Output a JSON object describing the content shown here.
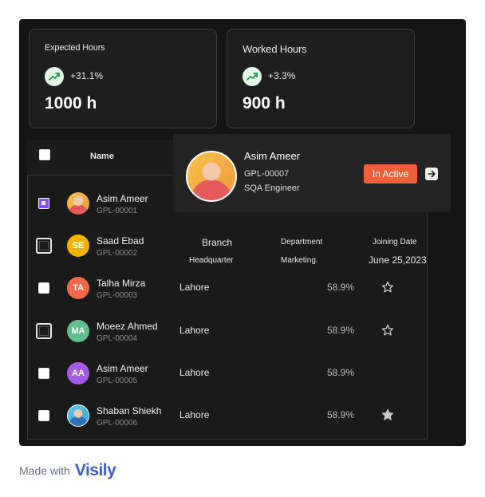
{
  "stats": [
    {
      "title": "Expected Hours",
      "change": "+31.1%",
      "value": "1000 h"
    },
    {
      "title": "Worked Hours",
      "change": "+3.3%",
      "value": "900 h"
    }
  ],
  "table": {
    "header_name": "Name",
    "sub_header": {
      "branch": "Branch",
      "department": "Department",
      "joining": "Joining Date"
    },
    "sub_values": {
      "branch": "Headquarter",
      "department": "Marketing.",
      "joining": "June 25,2023"
    },
    "rows": [
      {
        "name": "Asim Ameer",
        "id": "GPL-00001",
        "initials": "",
        "location": "",
        "percent": ""
      },
      {
        "name": "Saad Ebad",
        "id": "GPL-00002",
        "initials": "SE",
        "location": "",
        "percent": ""
      },
      {
        "name": "Talha Mirza",
        "id": "GPL-00003",
        "initials": "TA",
        "location": "Lahore",
        "percent": "58.9%"
      },
      {
        "name": "Moeez Ahmed",
        "id": "GPL-00004",
        "initials": "MA",
        "location": "Lahore",
        "percent": "58.9%"
      },
      {
        "name": "Asim Ameer",
        "id": "GPL-00005",
        "initials": "AA",
        "location": "Lahore",
        "percent": "58.9%"
      },
      {
        "name": "Shaban Shiekh",
        "id": "GPL-00006",
        "initials": "",
        "location": "Lahore",
        "percent": "58.9%"
      }
    ]
  },
  "popup": {
    "name": "Asim Ameer",
    "id": "GPL-00007",
    "role": "SQA Engineer",
    "status": "In Active"
  },
  "footer": {
    "made_with": "Made with",
    "brand": "Visily"
  },
  "colors": {
    "accent": "#8a4dff",
    "inactive": "#f0603c",
    "trend": "#1e9e4a",
    "brand": "#3b5bdb"
  }
}
